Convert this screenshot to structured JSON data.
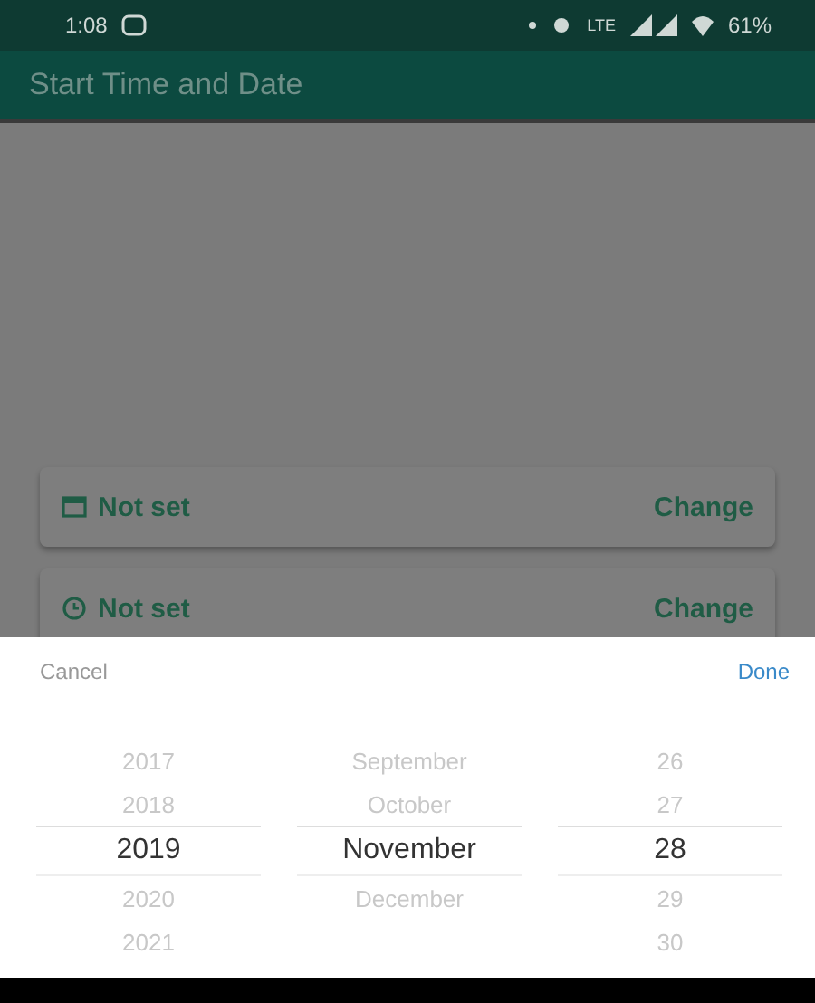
{
  "status_bar": {
    "time": "1:08",
    "network": "LTE",
    "battery": "61%"
  },
  "app_bar": {
    "title": "Start Time and Date"
  },
  "cards": [
    {
      "kind": "date",
      "value": "Not set",
      "action": "Change"
    },
    {
      "kind": "time",
      "value": "Not set",
      "action": "Change"
    }
  ],
  "sheet": {
    "cancel": "Cancel",
    "done": "Done"
  },
  "picker": [
    {
      "items": [
        {
          "label": "2017",
          "selected": false
        },
        {
          "label": "2018",
          "selected": false
        },
        {
          "label": "2019",
          "selected": true
        },
        {
          "label": "2020",
          "selected": false
        },
        {
          "label": "2021",
          "selected": false
        }
      ]
    },
    {
      "items": [
        {
          "label": "September",
          "selected": false
        },
        {
          "label": "October",
          "selected": false
        },
        {
          "label": "November",
          "selected": true
        },
        {
          "label": "December",
          "selected": false
        }
      ]
    },
    {
      "items": [
        {
          "label": "26",
          "selected": false
        },
        {
          "label": "27",
          "selected": false
        },
        {
          "label": "28",
          "selected": true
        },
        {
          "label": "29",
          "selected": false
        },
        {
          "label": "30",
          "selected": false
        }
      ]
    }
  ]
}
